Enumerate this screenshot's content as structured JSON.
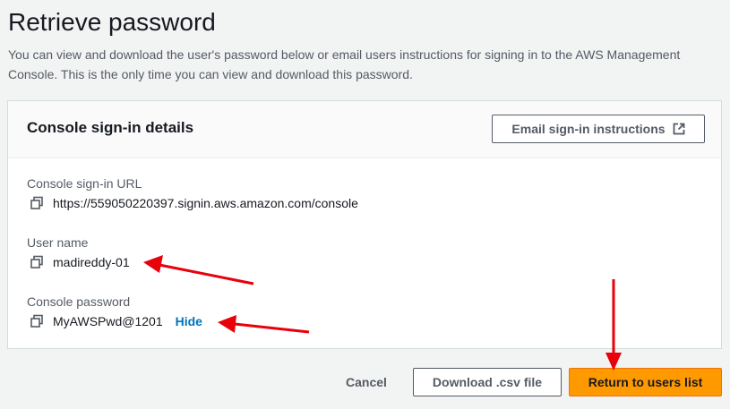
{
  "page": {
    "title": "Retrieve password",
    "description": "You can view and download the user's password below or email users instructions for signing in to the AWS Management Console. This is the only time you can view and download this password."
  },
  "panel": {
    "title": "Console sign-in details",
    "email_button_label": "Email sign-in instructions",
    "email_button_icon": "external-link-icon",
    "fields": {
      "url": {
        "label": "Console sign-in URL",
        "value": "https://559050220397.signin.aws.amazon.com/console",
        "icon": "copy-icon"
      },
      "username": {
        "label": "User name",
        "value": "madireddy-01",
        "icon": "copy-icon"
      },
      "password": {
        "label": "Console password",
        "value": "MyAWSPwd@1201",
        "icon": "copy-icon",
        "toggle_label": "Hide"
      }
    }
  },
  "footer": {
    "cancel_label": "Cancel",
    "download_label": "Download .csv file",
    "return_label": "Return to users list"
  },
  "colors": {
    "background": "#f2f3f3",
    "primary_button": "#ff9900",
    "link": "#0073bb",
    "annotation_arrow": "#e8000b"
  }
}
